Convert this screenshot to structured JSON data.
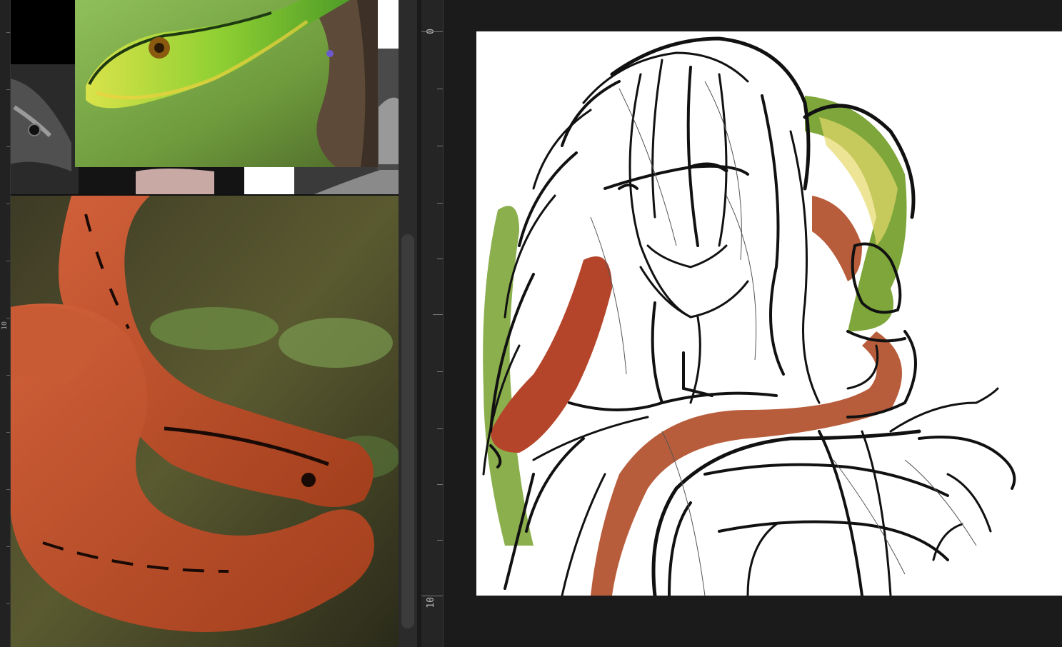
{
  "rulers": {
    "main_labels": [
      "0",
      "10"
    ],
    "left_label": "10"
  },
  "references": [
    {
      "name": "green-snake-photo",
      "icon": "snake-photo"
    },
    {
      "name": "black-snake-photo",
      "icon": "snake-photo"
    },
    {
      "name": "red-snake-photo",
      "icon": "snake-photo"
    }
  ],
  "colors": {
    "app_background": "#1f1f1f",
    "canvas_background": "#ffffff",
    "sketch_green": "#7ea63a",
    "sketch_red": "#b5452a",
    "sketch_orange": "#b85d3c",
    "sketch_yellow": "#e6d96a"
  }
}
